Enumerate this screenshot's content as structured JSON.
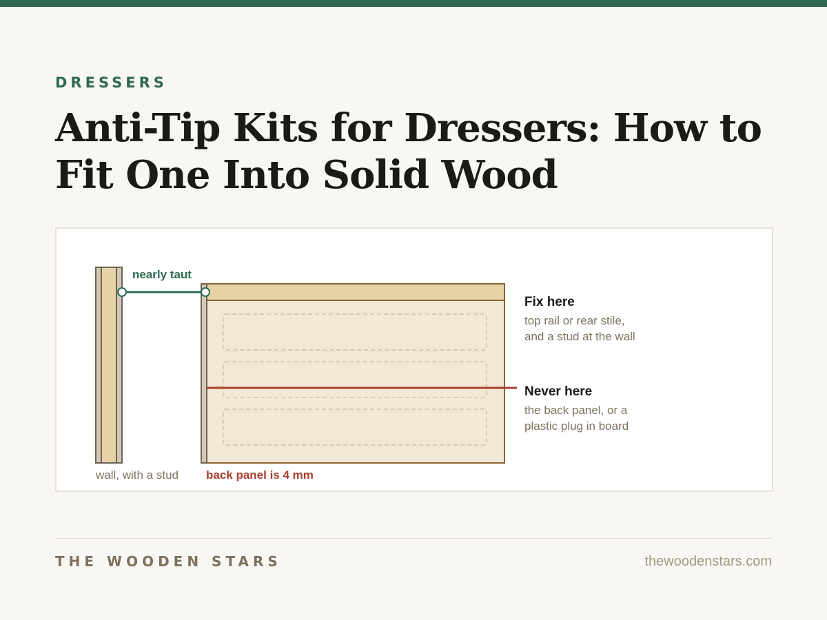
{
  "header": {
    "category": "DRESSERS",
    "title": "Anti-Tip Kits for Dressers: How to Fit One Into Solid Wood"
  },
  "diagram": {
    "strap_label": "nearly taut",
    "wall_label": "wall, with a stud",
    "back_panel_label": "back panel is 4 mm",
    "fix": {
      "heading": "Fix here",
      "line1": "top rail or rear stile,",
      "line2": "and a stud at the wall"
    },
    "never": {
      "heading": "Never here",
      "line1": "the back panel, or a",
      "line2": "plastic plug in board"
    }
  },
  "footer": {
    "brand": "THE WOODEN STARS",
    "site": "thewoodenstars.com"
  },
  "colors": {
    "accent_green": "#2e6a4f",
    "warning_red": "#a8402d",
    "wood_tan": "#e8d2a8",
    "panel_cream": "#f3e8d5",
    "frame_brown": "#8a6238"
  }
}
